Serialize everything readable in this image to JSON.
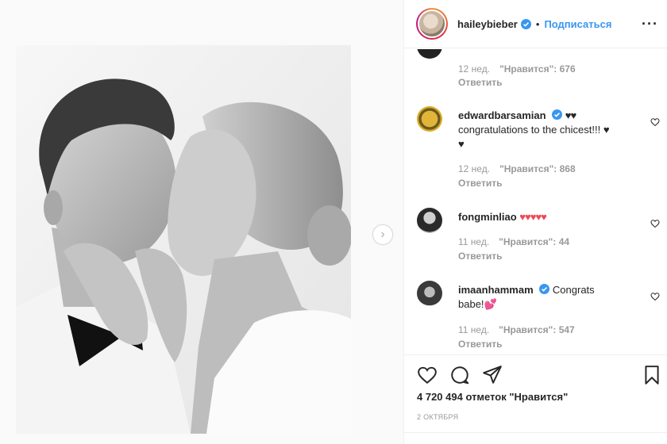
{
  "header": {
    "username": "haileybieber",
    "separator": "•",
    "follow_label": "Подписаться",
    "more_label": "···"
  },
  "comments": [
    {
      "time": "12 нед.",
      "likes": "\"Нравится\": 676",
      "reply": "Ответить"
    },
    {
      "username": "edwardbarsamian",
      "text": "congratulations to the chicest!!!",
      "lead_hearts": "♥♥",
      "trail_heart": "♥",
      "trail_heart2": "♥",
      "time": "12 нед.",
      "likes": "\"Нравится\": 868",
      "reply": "Ответить"
    },
    {
      "username": "fongminliao",
      "hearts": "♥♥♥♥♥",
      "time": "11 нед.",
      "likes": "\"Нравится\": 44",
      "reply": "Ответить"
    },
    {
      "username": "imaanhammam",
      "text": "Congrats",
      "text2": "babe!",
      "emoji": "💕",
      "time": "11 нед.",
      "likes": "\"Нравится\": 547",
      "reply": "Ответить"
    }
  ],
  "footer": {
    "likes_count": "4 720 494 отметок \"Нравится\"",
    "date": "2 ОКТЯБРЯ"
  },
  "icons": {
    "heart": "heart-icon",
    "comment": "comment-icon",
    "share": "share-icon",
    "save": "bookmark-icon",
    "next": "chevron-right-icon",
    "verified": "verified-badge-icon"
  },
  "colors": {
    "link_blue": "#3897f0",
    "verified_blue": "#3897f0",
    "heart_red": "#ed4956",
    "meta_gray": "#999999"
  }
}
